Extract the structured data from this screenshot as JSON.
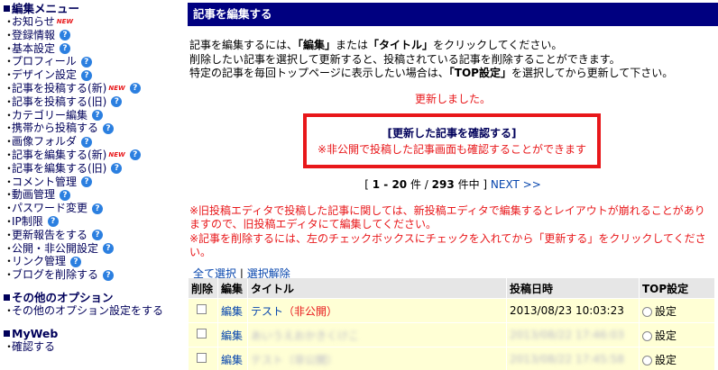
{
  "sidebar": {
    "edit_menu_heading": "編集メニュー",
    "items": [
      {
        "label": "お知らせ",
        "badge": "NEW",
        "help": false
      },
      {
        "label": "登録情報",
        "help": true
      },
      {
        "label": "基本設定",
        "help": true
      },
      {
        "label": "プロフィール",
        "help": true
      },
      {
        "label": "デザイン設定",
        "help": true
      },
      {
        "label": "記事を投稿する(新)",
        "badge": "NEW",
        "help": true
      },
      {
        "label": "記事を投稿する(旧)",
        "help": true
      },
      {
        "label": "カテゴリー編集",
        "help": true
      },
      {
        "label": "携帯から投稿する",
        "help": true
      },
      {
        "label": "画像フォルダ",
        "help": true
      },
      {
        "label": "記事を編集する(新)",
        "badge": "NEW",
        "help": true
      },
      {
        "label": "記事を編集する(旧)",
        "help": true
      },
      {
        "label": "コメント管理",
        "help": true
      },
      {
        "label": "動画管理",
        "help": true
      },
      {
        "label": "パスワード変更",
        "help": true
      },
      {
        "label": "IP制限",
        "help": true
      },
      {
        "label": "更新報告をする",
        "help": true
      },
      {
        "label": "公開・非公開設定",
        "help": true
      },
      {
        "label": "リンク管理",
        "help": true
      },
      {
        "label": "ブログを削除する",
        "help": true
      }
    ],
    "other_heading": "その他のオプション",
    "other_items": [
      {
        "label": "その他のオプション設定をする"
      }
    ],
    "myweb_heading": "MyWeb",
    "myweb_items": [
      {
        "label": "確認する"
      }
    ],
    "bullet": "・",
    "help_glyph": "?"
  },
  "main": {
    "title": "記事を編集する",
    "intro": {
      "line1_pre": "記事を編集するには、",
      "line1_b1": "「編集」",
      "line1_mid": "または",
      "line1_b2": "「タイトル」",
      "line1_post": "をクリックしてください。",
      "line2": "削除したい記事を選択して更新すると、投稿されている記事を削除することができます。",
      "line3_pre": "特定の記事を毎回トップページに表示したい場合は、",
      "line3_b": "「TOP設定」",
      "line3_post": "を選択してから更新して下さい。"
    },
    "updated_message": "更新しました。",
    "confirm_link": "[更新した記事を確認する]",
    "confirm_note": "※非公開で投稿した記事画面も確認することができます",
    "pager": {
      "open": "[",
      "range": "1 - 20",
      "unit": "件 /",
      "total": "293",
      "total_unit": "件中",
      "close": "]",
      "next": "NEXT >>"
    },
    "warnings": [
      "※旧投稿エディタで投稿した記事に関しては、新投稿エディタで編集するとレイアウトが崩れることがあり",
      "ますので、旧投稿エディタにて編集してください。",
      "※記事を削除するには、左のチェックボックスにチェックを入れてから「更新する」をクリックしてくださ",
      "い。"
    ],
    "select_all": "全て選択",
    "separator": "|",
    "deselect": "選択解除",
    "table": {
      "headers": [
        "削除",
        "編集",
        "タイトル",
        "投稿日時",
        "TOP設定"
      ],
      "rows": [
        {
          "edit": "編集",
          "title": "テスト",
          "status": "（非公開）",
          "date": "2013/08/23 10:03:23",
          "top": "設定",
          "blurred": false
        },
        {
          "edit": "編集",
          "title": "あいうえおかきくけこ",
          "status": "",
          "date": "2013/08/22 17:46:03",
          "top": "設定",
          "blurred": true
        },
        {
          "edit": "編集",
          "title": "テスト",
          "status": "（非公開）",
          "date": "2013/08/22 17:45:58",
          "top": "設定",
          "blurred": true
        }
      ]
    }
  },
  "colors": {
    "title_bar": "#000080",
    "accent_red": "#e8171a",
    "link": "#0645ad",
    "row_bg": "#ffffd5",
    "header_bg": "#e6e6e6"
  }
}
